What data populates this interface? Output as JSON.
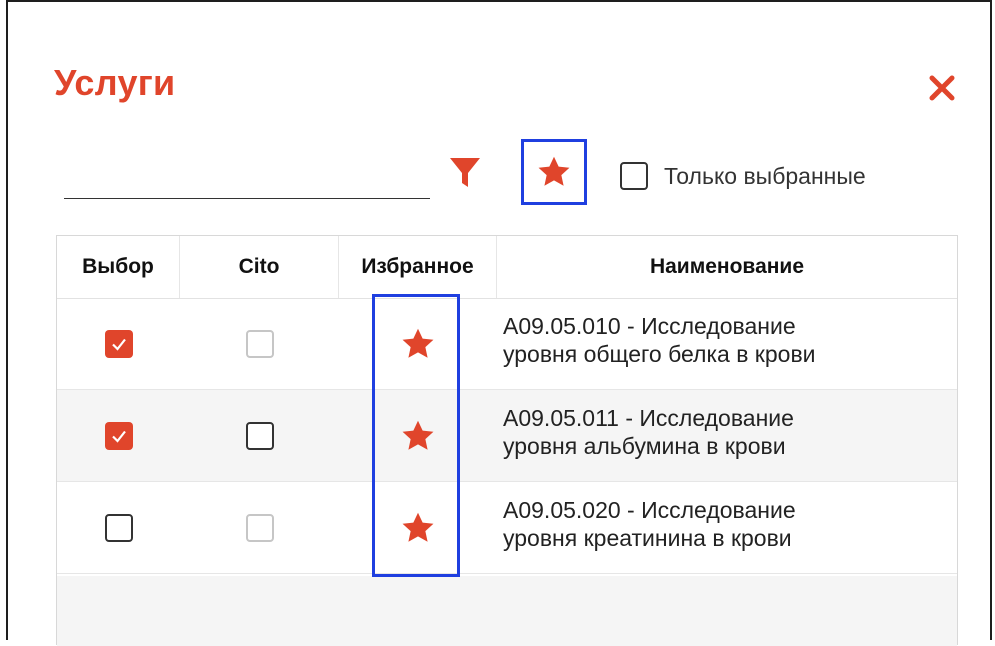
{
  "dialog": {
    "title": "Услуги",
    "close_icon": "close-icon",
    "search": {
      "value": "",
      "placeholder": ""
    },
    "filter_icon": "filter-icon",
    "favorites_button_icon": "star-icon",
    "only_selected": {
      "label": "Только выбранные",
      "checked": false
    }
  },
  "colors": {
    "accent": "#e0452b",
    "highlight": "#1f3fe0"
  },
  "table": {
    "columns": [
      "Выбор",
      "Cito",
      "Избранное",
      "Наименование"
    ],
    "rows": [
      {
        "select": true,
        "cito": false,
        "cito_style": "light",
        "favorite": true,
        "name_line1": "A09.05.010 - Исследование",
        "name_line2": "уровня общего белка в крови"
      },
      {
        "select": true,
        "cito": false,
        "cito_style": "dark",
        "favorite": true,
        "name_line1": "A09.05.011 - Исследование",
        "name_line2": "уровня альбумина в крови"
      },
      {
        "select": false,
        "cito": false,
        "cito_style": "light",
        "favorite": true,
        "name_line1": "A09.05.020 - Исследование",
        "name_line2": "уровня креатинина в крови"
      }
    ]
  }
}
